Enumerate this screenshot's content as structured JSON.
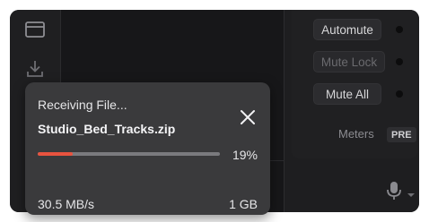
{
  "mixer": {
    "automute_label": "Automute",
    "mutelock_label": "Mute Lock",
    "muteall_label": "Mute All",
    "meters_label": "Meters",
    "pre_badge": "PRE"
  },
  "rail": {
    "icons": [
      "card-icon",
      "download-icon"
    ]
  },
  "toast": {
    "heading": "Receiving File...",
    "filename": "Studio_Bed_Tracks.zip",
    "percent_text": "19%",
    "progress": 0.19,
    "speed": "30.5 MB/s",
    "size": "1 GB"
  },
  "colors": {
    "accent": "#e8533f",
    "toast_bg": "#3a3a3c",
    "window_bg": "#1b1b1d"
  }
}
